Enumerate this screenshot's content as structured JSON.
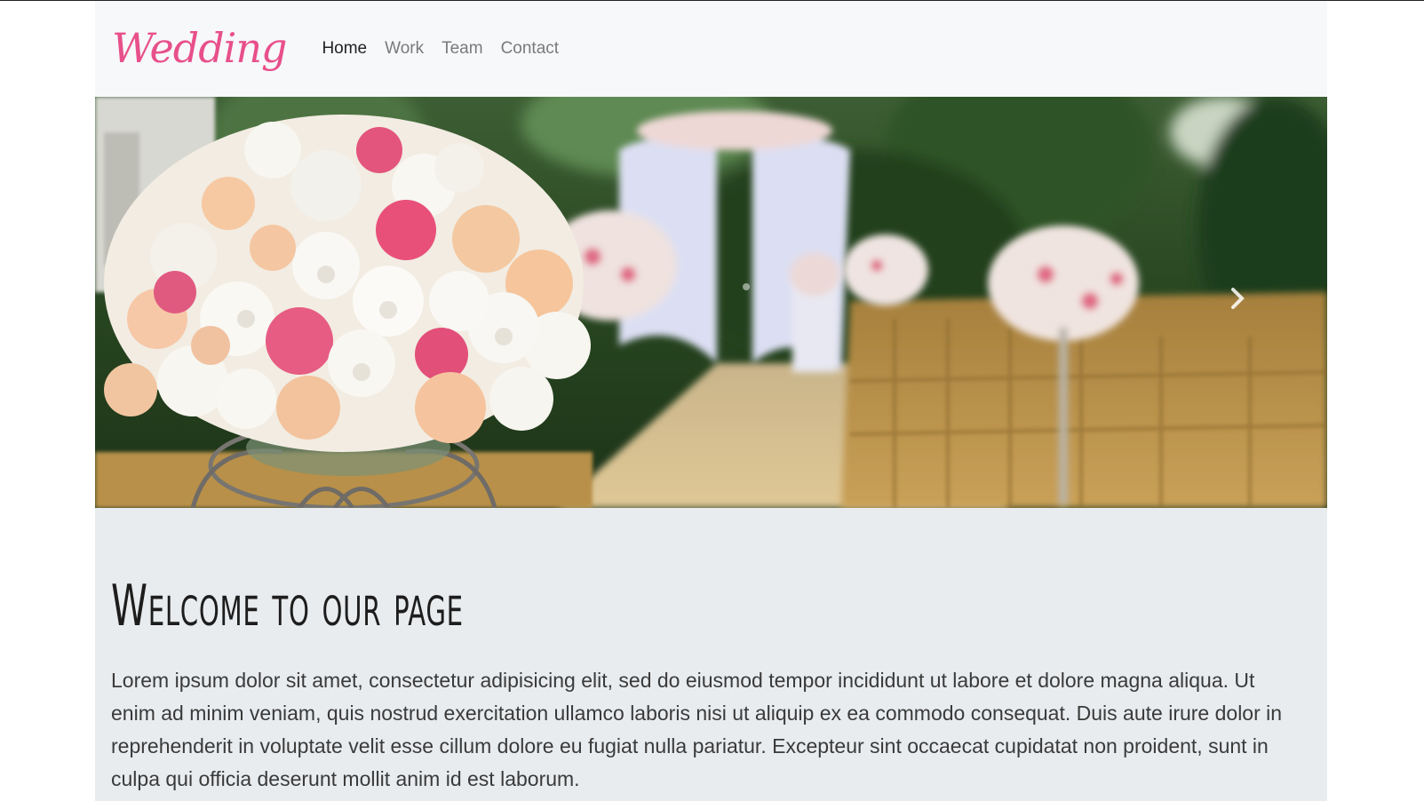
{
  "navbar": {
    "brand": "Wedding",
    "links": [
      {
        "label": "Home",
        "active": true
      },
      {
        "label": "Work",
        "active": false
      },
      {
        "label": "Team",
        "active": false
      },
      {
        "label": "Contact",
        "active": false
      }
    ]
  },
  "hero": {
    "image_alt_semantic": "wedding-aisle-flowers-image",
    "next_icon": "chevron-right-icon"
  },
  "content": {
    "title": "Welcome to our page",
    "body": "Lorem ipsum dolor sit amet, consectetur adipisicing elit, sed do eiusmod tempor incididunt ut labore et dolore magna aliqua. Ut enim ad minim veniam, quis nostrud exercitation ullamco laboris nisi ut aliquip ex ea commodo consequat. Duis aute irure dolor in reprehenderit in voluptate velit esse cillum dolore eu fugiat nulla pariatur. Excepteur sint occaecat cupidatat non proident, sunt in culpa qui officia deserunt mollit anim id est laborum."
  },
  "colors": {
    "brand": "#e8508b",
    "navbar_bg": "#f7f8fa",
    "jumbotron_bg": "#e9ecef"
  }
}
